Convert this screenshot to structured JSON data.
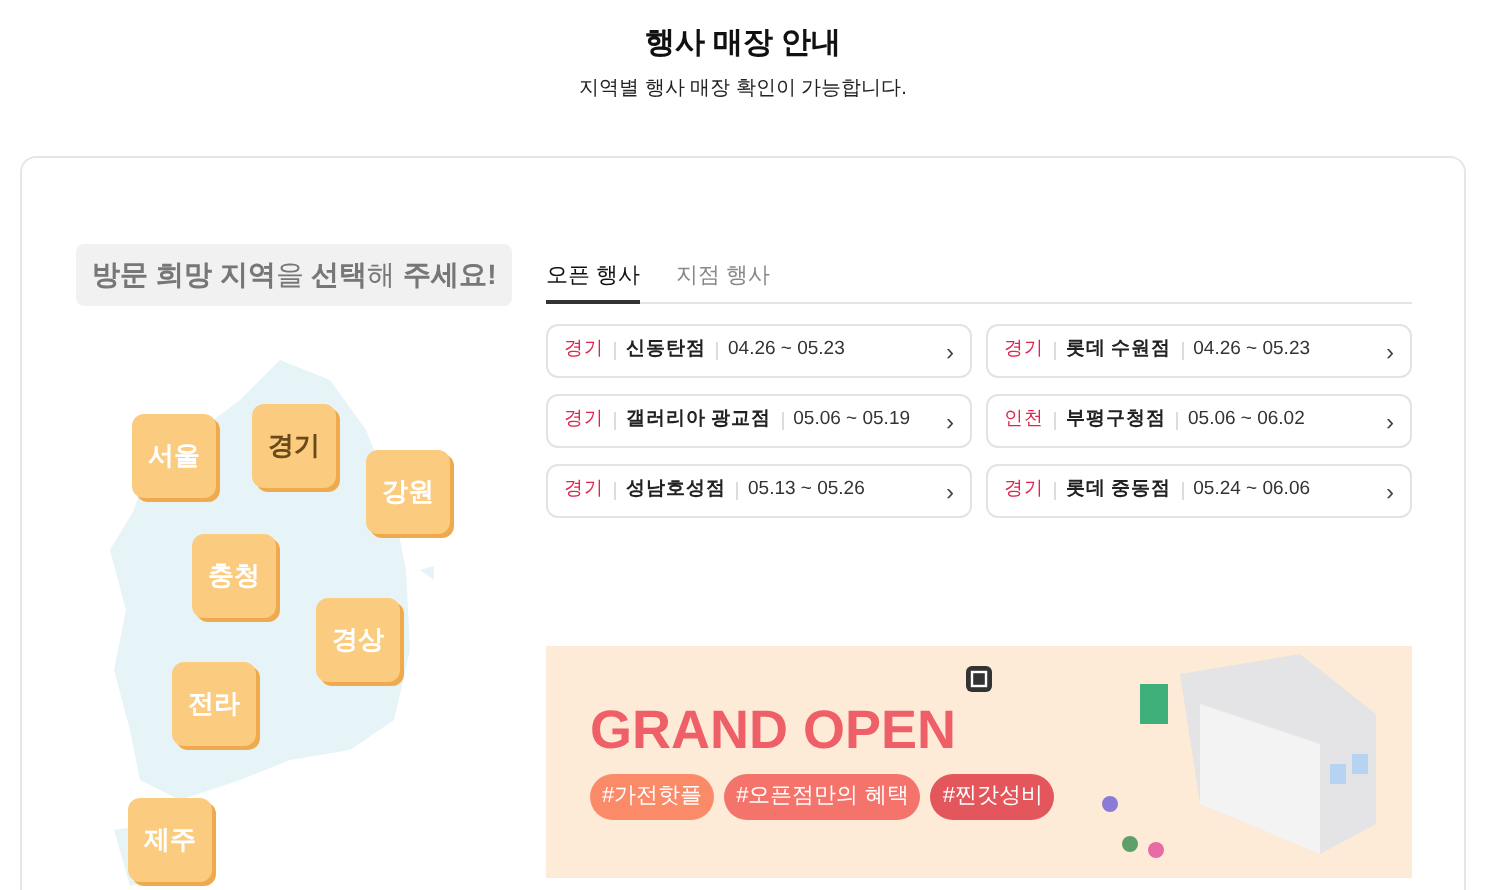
{
  "header": {
    "title": "행사 매장 안내",
    "subtitle": "지역별 행사 매장 확인이 가능합니다."
  },
  "region_prompt": "**방문 희망 지역**을 **선택**해 **주세요!**",
  "regions": [
    {
      "label": "서울",
      "selected": false
    },
    {
      "label": "경기",
      "selected": true
    },
    {
      "label": "강원",
      "selected": false
    },
    {
      "label": "충청",
      "selected": false
    },
    {
      "label": "경상",
      "selected": false
    },
    {
      "label": "전라",
      "selected": false
    },
    {
      "label": "제주",
      "selected": false
    }
  ],
  "tabs": [
    {
      "label": "오픈 행사",
      "selected": true
    },
    {
      "label": "지점 행사",
      "selected": false
    }
  ],
  "stores": [
    {
      "region": "경기",
      "name": "신동탄점",
      "period": "04.26 ~ 05.23",
      "arrow": "›"
    },
    {
      "region": "경기",
      "name": "롯데 수원점",
      "period": "04.26 ~ 05.23",
      "arrow": "›"
    },
    {
      "region": "경기",
      "name": "갤러리아 광교점",
      "period": "05.06 ~ 05.19",
      "arrow": "›"
    },
    {
      "region": "인천",
      "name": "부평구청점",
      "period": "05.06 ~ 06.02",
      "arrow": "›"
    },
    {
      "region": "경기",
      "name": "성남호성점",
      "period": "05.13 ~ 05.26",
      "arrow": "›"
    },
    {
      "region": "경기",
      "name": "롯데 중동점",
      "period": "05.24 ~ 06.06",
      "arrow": "›"
    }
  ],
  "banner": {
    "headline": "GRAND OPEN",
    "hashtags": [
      {
        "text": "#가전핫플",
        "color": "#fb8a68"
      },
      {
        "text": "#오픈점만의 혜택",
        "color": "#f4736a"
      },
      {
        "text": "#찐갓성비",
        "color": "#e3565c"
      }
    ]
  }
}
